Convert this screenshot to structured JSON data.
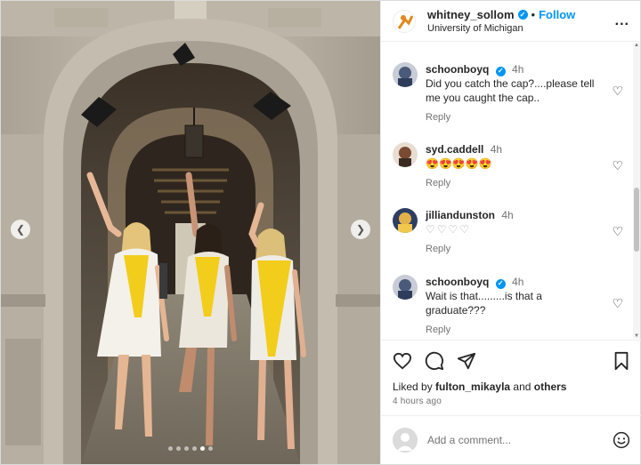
{
  "header": {
    "username": "whitney_sollom",
    "separator": "•",
    "follow_label": "Follow",
    "location": "University of Michigan",
    "more_label": "..."
  },
  "comments": [
    {
      "username": "schoonboyq",
      "verified": true,
      "time": "4h",
      "text": "Did you catch the cap?....please tell me you caught the cap..",
      "reply": "Reply"
    },
    {
      "username": "syd.caddell",
      "verified": false,
      "time": "4h",
      "text": "😍😍😍😍😍",
      "reply": "Reply"
    },
    {
      "username": "jillianduns­ton",
      "verified": false,
      "time": "4h",
      "text": "♡♡♡♡",
      "reply": "Reply"
    },
    {
      "username": "schoonboyq",
      "verified": true,
      "time": "4h",
      "text": "Wait is that.........is that a graduate???",
      "reply": "Reply"
    }
  ],
  "likes": {
    "prefix": "Liked by",
    "user": "fulton_mikayla",
    "middle": "and",
    "others": "others"
  },
  "time_ago": "4 hours ago",
  "add_comment": {
    "placeholder": "Add a comment..."
  },
  "carousel": {
    "dots": 6,
    "active_index": 4
  },
  "colors": {
    "accent": "#0095f6",
    "muted": "#737373",
    "maize": "#f2cd1c"
  },
  "icons": [
    "heart-icon",
    "comment-icon",
    "share-icon",
    "bookmark-icon",
    "emoji-icon",
    "more-icon",
    "verified-icon",
    "chevron-left-icon",
    "chevron-right-icon"
  ]
}
